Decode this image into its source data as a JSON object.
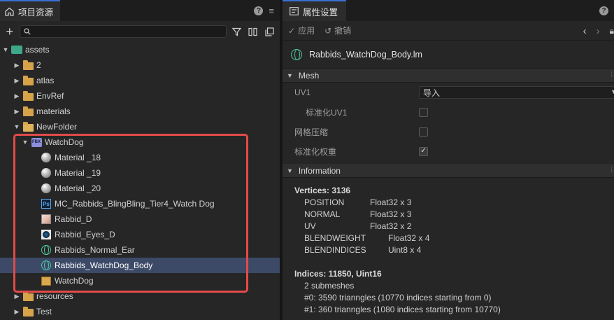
{
  "left_panel": {
    "tab_title": "项目资源",
    "help": "?",
    "menu": "≡",
    "search_placeholder": ""
  },
  "tree": [
    {
      "label": "assets",
      "depth": 0,
      "icon": "assets-folder-icon",
      "arrow": "▼"
    },
    {
      "label": "2",
      "depth": 1,
      "icon": "folder-icon",
      "arrow": "▶"
    },
    {
      "label": "atlas",
      "depth": 1,
      "icon": "folder-icon",
      "arrow": "▶"
    },
    {
      "label": "EnvRef",
      "depth": 1,
      "icon": "folder-icon",
      "arrow": "▶"
    },
    {
      "label": "materials",
      "depth": 1,
      "icon": "folder-icon",
      "arrow": "▶"
    },
    {
      "label": "NewFolder",
      "depth": 1,
      "icon": "folder-open-icon",
      "arrow": "▼"
    },
    {
      "label": "WatchDog",
      "depth": 2,
      "icon": "fbx-icon",
      "arrow": "▼"
    },
    {
      "label": "Material _18",
      "depth": 3,
      "icon": "material-sphere-icon",
      "arrow": ""
    },
    {
      "label": "Material _19",
      "depth": 3,
      "icon": "material-sphere-icon",
      "arrow": ""
    },
    {
      "label": "Material _20",
      "depth": 3,
      "icon": "material-sphere-icon",
      "arrow": ""
    },
    {
      "label": "MC_Rabbids_BlingBling_Tier4_Watch Dog",
      "depth": 3,
      "icon": "photoshop-icon",
      "arrow": ""
    },
    {
      "label": "Rabbid_D",
      "depth": 3,
      "icon": "texture-icon",
      "arrow": ""
    },
    {
      "label": "Rabbid_Eyes_D",
      "depth": 3,
      "icon": "texture-eye-icon",
      "arrow": ""
    },
    {
      "label": "Rabbids_Normal_Ear",
      "depth": 3,
      "icon": "mesh-icon",
      "arrow": ""
    },
    {
      "label": "Rabbids_WatchDog_Body",
      "depth": 3,
      "icon": "mesh-icon",
      "arrow": "",
      "selected": true
    },
    {
      "label": "WatchDog",
      "depth": 3,
      "icon": "prefab-box-icon",
      "arrow": ""
    },
    {
      "label": "resources",
      "depth": 1,
      "icon": "folder-icon",
      "arrow": "▶"
    },
    {
      "label": "Test",
      "depth": 1,
      "icon": "folder-icon",
      "arrow": "▶"
    }
  ],
  "right_panel": {
    "tab_title": "属性设置",
    "help": "?",
    "apply": "应用",
    "revert": "撤销",
    "file_name": "Rabbids_WatchDog_Body.lm",
    "mesh_section": "Mesh",
    "uv1_label": "UV1",
    "uv1_value": "导入",
    "normalize_uv1_label": "标准化UV1",
    "normalize_uv1_checked": false,
    "mesh_compress_label": "网格压缩",
    "mesh_compress_checked": false,
    "normalize_weight_label": "标准化权重",
    "normalize_weight_checked": true,
    "info_section": "Information",
    "vertices_title": "Vertices: 3136",
    "attributes": [
      {
        "name": "POSITION",
        "type": "Float32 x 3"
      },
      {
        "name": "NORMAL",
        "type": "Float32 x 3"
      },
      {
        "name": "UV",
        "type": "Float32 x 2"
      },
      {
        "name": "BLENDWEIGHT",
        "type": "Float32 x 4"
      },
      {
        "name": "BLENDINDICES",
        "type": "Uint8 x 4"
      }
    ],
    "indices_title": "Indices: 11850, Uint16",
    "submeshes": "2 submeshes",
    "submesh_0": "#0: 3590 trianngles (10770 indices starting from 0)",
    "submesh_1": "#1: 360 trianngles (1080 indices starting from 10770)"
  }
}
